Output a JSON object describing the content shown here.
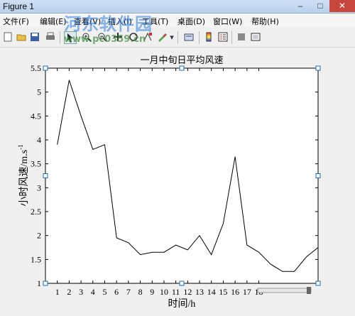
{
  "window": {
    "title": "Figure 1",
    "min": "–",
    "max": "□",
    "close": "✕"
  },
  "menu": [
    {
      "label": "文件(F)"
    },
    {
      "label": "编辑(E)"
    },
    {
      "label": "查看(V)"
    },
    {
      "label": "插入(I)"
    },
    {
      "label": "工具(T)"
    },
    {
      "label": "桌面(D)"
    },
    {
      "label": "窗口(W)"
    },
    {
      "label": "帮助(H)"
    }
  ],
  "watermark": {
    "title": "河东软件园",
    "url": "www.pc0359.cn"
  },
  "toolbar": {
    "icons": [
      "new-figure-icon",
      "open-file-icon",
      "save-icon",
      "print-icon",
      "pointer-icon",
      "zoom-in-icon",
      "zoom-out-icon",
      "pan-icon",
      "rotate-icon",
      "data-cursor-icon",
      "brush-icon",
      "link-icon",
      "colorbar-icon",
      "legend-icon",
      "hide-tools-icon",
      "show-tools-icon"
    ]
  },
  "chart_data": {
    "type": "line",
    "title": "一月中旬日平均风速",
    "xlabel": "时间/h",
    "ylabel": "小时风速/m.s",
    "ylabel_sup": "-1",
    "xlim": [
      0,
      23
    ],
    "ylim": [
      1,
      5.5
    ],
    "x_ticks": [
      1,
      2,
      3,
      4,
      5,
      6,
      7,
      8,
      9,
      10,
      11,
      12,
      13,
      14,
      15,
      16,
      17,
      18
    ],
    "y_ticks": [
      1,
      1.5,
      2,
      2.5,
      3,
      3.5,
      4,
      4.5,
      5,
      5.5
    ],
    "y_tick_labels": [
      "1",
      "1.5",
      "2",
      "2.5",
      "3",
      "3.5",
      "4",
      "4.5",
      "5",
      "5.5"
    ],
    "series": [
      {
        "x": [
          1,
          2,
          3,
          4,
          5,
          6,
          7,
          8,
          9,
          10,
          11,
          12,
          13,
          14,
          15,
          16,
          17,
          18,
          19,
          20,
          21,
          22,
          23
        ],
        "values": [
          3.9,
          5.25,
          4.5,
          3.8,
          3.9,
          1.95,
          1.85,
          1.6,
          1.65,
          1.65,
          1.8,
          1.7,
          2.0,
          1.6,
          2.25,
          3.65,
          1.8,
          1.65,
          1.4,
          1.25,
          1.25,
          1.55,
          1.75
        ]
      }
    ],
    "grid": false,
    "color": "#000000"
  }
}
